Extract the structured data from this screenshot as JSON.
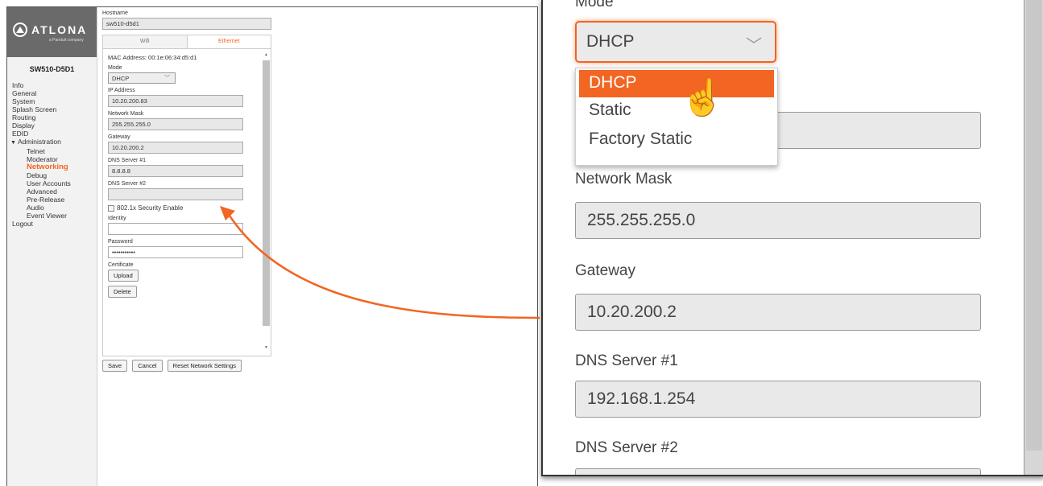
{
  "app": {
    "logo_text": "ATLONA",
    "logo_sub": "a Panduit company",
    "device_name": "SW510-D5D1",
    "nav": [
      {
        "label": "Info",
        "type": "top"
      },
      {
        "label": "General",
        "type": "top"
      },
      {
        "label": "System",
        "type": "top"
      },
      {
        "label": "Splash Screen",
        "type": "top"
      },
      {
        "label": "Routing",
        "type": "top"
      },
      {
        "label": "Display",
        "type": "top"
      },
      {
        "label": "EDID",
        "type": "top"
      },
      {
        "label": "Administration",
        "type": "group"
      },
      {
        "label": "Telnet",
        "type": "sub"
      },
      {
        "label": "Moderator",
        "type": "sub"
      },
      {
        "label": "Networking",
        "type": "sub",
        "active": true
      },
      {
        "label": "Debug",
        "type": "sub"
      },
      {
        "label": "User Accounts",
        "type": "sub"
      },
      {
        "label": "Advanced",
        "type": "sub"
      },
      {
        "label": "Pre-Release",
        "type": "sub"
      },
      {
        "label": "Audio",
        "type": "sub"
      },
      {
        "label": "Event Viewer",
        "type": "sub"
      },
      {
        "label": "Logout",
        "type": "top"
      }
    ],
    "hostname_label": "Hostname",
    "hostname_value": "sw510-d5d1",
    "tabs": {
      "wifi": "Wifi",
      "ethernet": "Ethernet"
    },
    "mac": "MAC Address: 00:1e:06:34:d5:d1",
    "mode_label": "Mode",
    "mode_value": "DHCP",
    "ip_label": "IP Address",
    "ip_value": "10.20.200.83",
    "mask_label": "Network Mask",
    "mask_value": "255.255.255.0",
    "gateway_label": "Gateway",
    "gateway_value": "10.20.200.2",
    "dns1_label": "DNS Server #1",
    "dns1_value": "8.8.8.8",
    "dns2_label": "DNS Server #2",
    "dns2_value": "",
    "security_label": "802.1x Security Enable",
    "identity_label": "Identity",
    "identity_value": "",
    "password_label": "Password",
    "password_value": "•••••••••••",
    "certificate_label": "Certificate",
    "upload_label": "Upload",
    "delete_label": "Delete",
    "save_label": "Save",
    "cancel_label": "Cancel",
    "reset_label": "Reset Network Settings"
  },
  "zoom": {
    "mode_label": "Mode",
    "mode_value": "DHCP",
    "options": [
      "DHCP",
      "Static",
      "Factory Static"
    ],
    "mask_label": "Network Mask",
    "mask_value": "255.255.255.0",
    "gateway_label": "Gateway",
    "gateway_value": "10.20.200.2",
    "dns1_label": "DNS Server #1",
    "dns1_value": "192.168.1.254",
    "dns2_label": "DNS Server #2"
  },
  "colors": {
    "accent": "#f26522",
    "sidebar_bg": "#f2f2f2",
    "logo_bg": "#6a6a6a"
  }
}
